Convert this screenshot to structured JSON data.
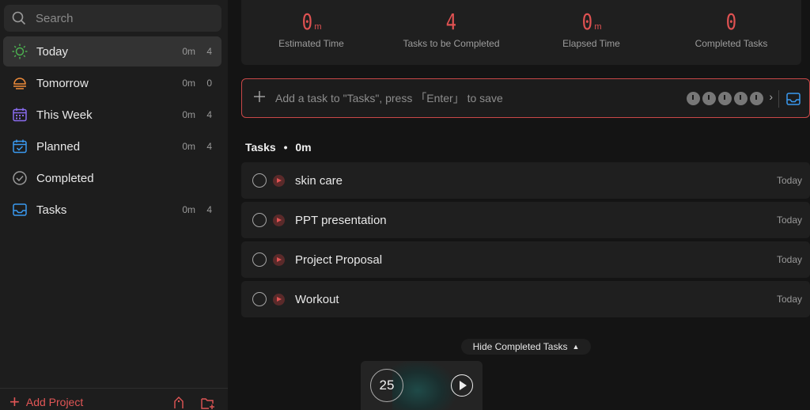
{
  "sidebar": {
    "search_placeholder": "Search",
    "items": [
      {
        "label": "Today",
        "time": "0m",
        "count": "4",
        "icon": "sun-icon",
        "color": "#4caf50"
      },
      {
        "label": "Tomorrow",
        "time": "0m",
        "count": "0",
        "icon": "sunset-icon",
        "color": "#f08c3a"
      },
      {
        "label": "This Week",
        "time": "0m",
        "count": "4",
        "icon": "calendar-week-icon",
        "color": "#8a6cf0"
      },
      {
        "label": "Planned",
        "time": "0m",
        "count": "4",
        "icon": "calendar-check-icon",
        "color": "#3a9af0"
      },
      {
        "label": "Completed",
        "time": "",
        "count": "",
        "icon": "check-circle-icon",
        "color": "#9a9a9a"
      },
      {
        "label": "Tasks",
        "time": "0m",
        "count": "4",
        "icon": "inbox-icon",
        "color": "#3a9af0"
      }
    ],
    "add_project_label": "Add Project"
  },
  "stats": [
    {
      "value": "0",
      "unit": "m",
      "label": "Estimated Time"
    },
    {
      "value": "4",
      "unit": "",
      "label": "Tasks to be Completed"
    },
    {
      "value": "0",
      "unit": "m",
      "label": "Elapsed Time"
    },
    {
      "value": "0",
      "unit": "",
      "label": "Completed Tasks"
    }
  ],
  "add_task": {
    "placeholder": "Add a task to \"Tasks\", press 「Enter」 to save"
  },
  "section": {
    "title": "Tasks",
    "separator": "•",
    "time": "0m"
  },
  "tasks": [
    {
      "name": "skin care",
      "date": "Today"
    },
    {
      "name": "PPT presentation",
      "date": "Today"
    },
    {
      "name": "Project Proposal",
      "date": "Today"
    },
    {
      "name": "Workout",
      "date": "Today"
    }
  ],
  "hide_completed_label": "Hide Completed Tasks",
  "timer": {
    "minutes": "25"
  },
  "colors": {
    "accent": "#e05252",
    "background": "#141414",
    "panel": "#1f1f1f"
  }
}
